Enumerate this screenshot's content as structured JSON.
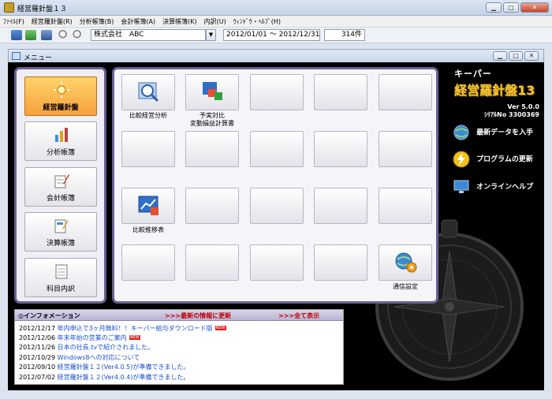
{
  "window": {
    "title": "経営羅針盤１３"
  },
  "menubar": [
    "ﾌｧｲﾙ(F)",
    "経営羅針盤(R)",
    "分析帳簿(B)",
    "会計帳簿(A)",
    "決算帳簿(K)",
    "内訳(U)",
    "ｳｨﾝﾄﾞｳ・ﾍﾙﾌﾟ(H)"
  ],
  "toolbar": {
    "company": "株式会社　ABC",
    "period": "2012/01/01 ～ 2012/12/31",
    "count": "314件"
  },
  "mdi": {
    "title": "メニュー"
  },
  "left_nav": [
    {
      "label": "経営羅針盤",
      "active": true
    },
    {
      "label": "分析帳簿"
    },
    {
      "label": "会計帳簿"
    },
    {
      "label": "決算帳簿"
    },
    {
      "label": "科目内訳"
    }
  ],
  "grid": {
    "items": {
      "compare_analysis": "比較経営分析",
      "budget_actual_1": "予実対比",
      "budget_actual_2": "変動損益計算書",
      "trend": "比較推移表",
      "communication": "通信設定"
    }
  },
  "brand": {
    "keeper": "キーパー",
    "product": "経営羅針盤13",
    "version": "Ver 5.0.0",
    "serial": "ｼﾘｱﾙNo 3300369"
  },
  "links": {
    "latest": "最新データを入手",
    "update": "プログラムの更新",
    "help": "オンラインヘルプ"
  },
  "info": {
    "title": "◎インフォメーション",
    "latest_link": ">>>最新の情報に更新",
    "all_link": ">>>全て表示",
    "news": [
      {
        "date": "2012/12/17",
        "text": "年内申込で3ヶ月無料！！キーパー給与ダウンロード版",
        "new": true
      },
      {
        "date": "2012/12/06",
        "text": "年末年始の営業のご案内",
        "new": true
      },
      {
        "date": "2012/11/26",
        "text": "日本の社長.tvで紹介されました。",
        "new": false
      },
      {
        "date": "2012/10/29",
        "text": "Windows8への対応について",
        "new": false
      },
      {
        "date": "2012/09/10",
        "text": "経営羅針盤１２(Ver4.0.5)が準備できました。",
        "new": false
      },
      {
        "date": "2012/07/02",
        "text": "経営羅針盤１２(Ver4.0.4)が準備できました。",
        "new": false
      }
    ],
    "new_badge": "NEW"
  }
}
